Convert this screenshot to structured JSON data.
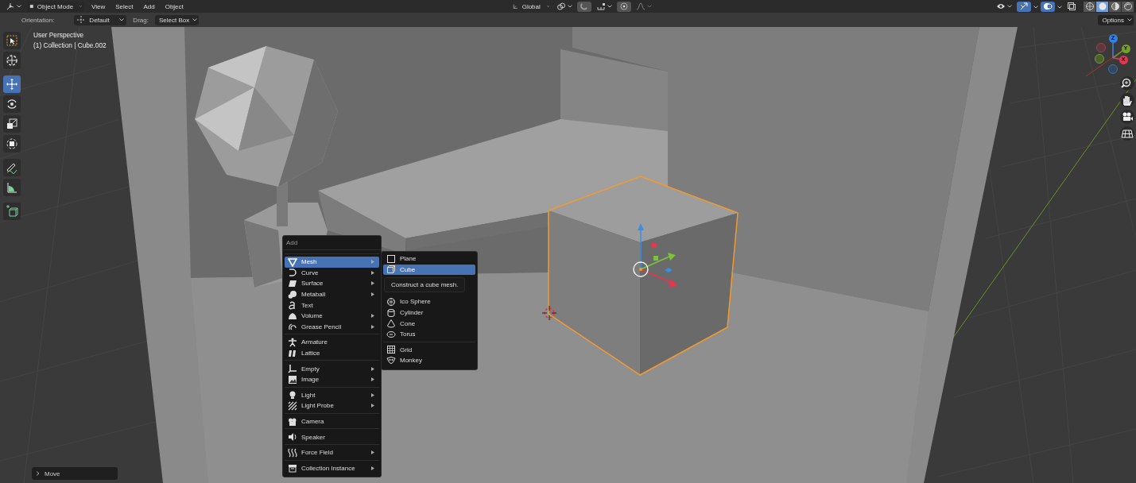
{
  "header": {
    "mode": "Object Mode",
    "menus": [
      "View",
      "Select",
      "Add",
      "Object"
    ],
    "orientation": "Global",
    "viewport_gizmos": {
      "on": true
    },
    "overlays": {
      "on": true
    },
    "xray": {
      "on": false
    },
    "shading_modes": [
      {
        "selected": false
      },
      {
        "selected": true
      },
      {
        "selected": false
      },
      {
        "selected": false
      }
    ]
  },
  "tool_settings": {
    "orientation_label": "Orientation:",
    "orientation": "Default",
    "drag_label": "Drag:",
    "drag": "Select Box",
    "options": "Options"
  },
  "viewport": {
    "overlay_text": [
      "User Perspective",
      "(1) Collection | Cube.002"
    ],
    "tools": [
      {
        "selected": false
      },
      {
        "selected": false
      },
      {
        "selected": true
      },
      {
        "selected": false
      },
      {
        "selected": false
      },
      {
        "selected": false
      },
      {
        "selected": false
      },
      {
        "selected": false
      },
      {
        "selected": false
      }
    ],
    "navigation_gizmo": {
      "axes": [
        {
          "label": "Z",
          "color": "#2f83e6"
        },
        {
          "label": "Y",
          "color": "#73a12b"
        },
        {
          "label": "X",
          "color": "#e8344e"
        }
      ]
    },
    "last_operator": {
      "label": "Move",
      "expanded": false
    }
  },
  "add_menu": {
    "title": "Add",
    "groups": [
      [
        {
          "label": "Mesh",
          "submenu": true,
          "selected": true
        },
        {
          "label": "Curve",
          "submenu": true,
          "selected": false
        },
        {
          "label": "Surface",
          "submenu": true,
          "selected": false
        },
        {
          "label": "Metaball",
          "submenu": true,
          "selected": false
        },
        {
          "label": "Text",
          "submenu": false,
          "selected": false
        },
        {
          "label": "Volume",
          "submenu": true,
          "selected": false
        },
        {
          "label": "Grease Pencil",
          "submenu": true,
          "selected": false
        }
      ],
      [
        {
          "label": "Armature",
          "submenu": false,
          "selected": false
        },
        {
          "label": "Lattice",
          "submenu": false,
          "selected": false
        }
      ],
      [
        {
          "label": "Empty",
          "submenu": true,
          "selected": false
        },
        {
          "label": "Image",
          "submenu": true,
          "selected": false
        }
      ],
      [
        {
          "label": "Light",
          "submenu": true,
          "selected": false
        },
        {
          "label": "Light Probe",
          "submenu": true,
          "selected": false
        }
      ],
      [
        {
          "label": "Camera",
          "submenu": false,
          "selected": false
        }
      ],
      [
        {
          "label": "Speaker",
          "submenu": false,
          "selected": false
        }
      ],
      [
        {
          "label": "Force Field",
          "submenu": true,
          "selected": false
        }
      ],
      [
        {
          "label": "Collection Instance",
          "submenu": true,
          "selected": false
        }
      ]
    ]
  },
  "mesh_menu": {
    "groups": [
      [
        {
          "label": "Plane",
          "selected": false
        },
        {
          "label": "Cube",
          "selected": true
        },
        {
          "label": "Ico Sphere",
          "selected": false
        },
        {
          "label": "Cylinder",
          "selected": false
        },
        {
          "label": "Cone",
          "selected": false
        },
        {
          "label": "Torus",
          "selected": false
        }
      ],
      [
        {
          "label": "Grid",
          "selected": false
        },
        {
          "label": "Monkey",
          "selected": false
        }
      ]
    ],
    "tooltip": "Construct a cube mesh."
  }
}
